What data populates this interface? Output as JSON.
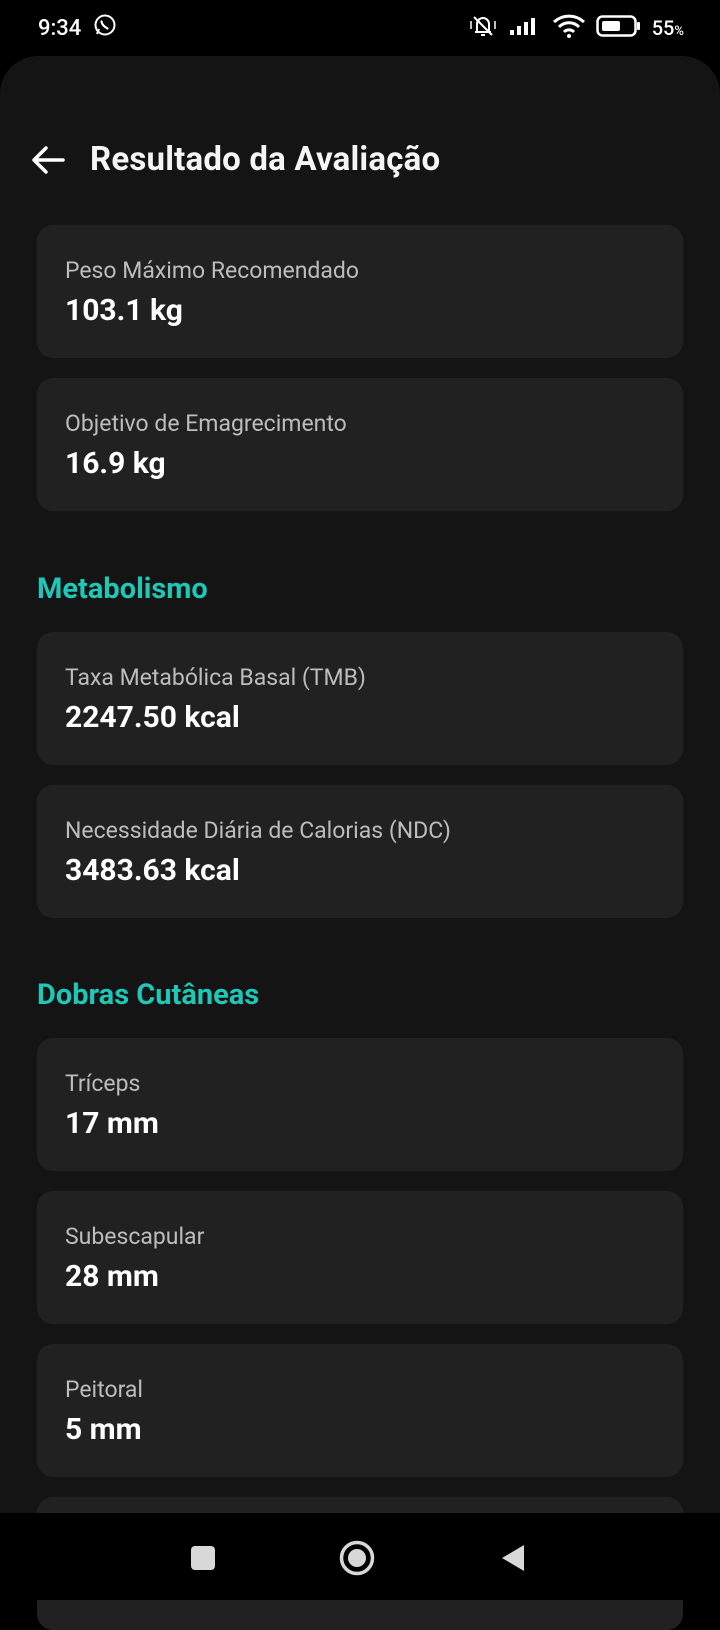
{
  "status_bar": {
    "time": "9:34",
    "battery_percent": "55",
    "battery_unit": "%",
    "icons": [
      "whatsapp-icon",
      "mute-icon",
      "signal-icon",
      "wifi-icon",
      "battery-icon"
    ]
  },
  "header": {
    "title": "Resultado da Avaliação"
  },
  "cards_top": [
    {
      "label": "Peso Máximo Recomendado",
      "value": "103.1 kg"
    },
    {
      "label": "Objetivo de Emagrecimento",
      "value": "16.9 kg"
    }
  ],
  "metabolismo": {
    "title": "Metabolismo",
    "cards": [
      {
        "label": "Taxa Metabólica Basal (TMB)",
        "value": "2247.50 kcal"
      },
      {
        "label": "Necessidade Diária de Calorias (NDC)",
        "value": "3483.63 kcal"
      }
    ]
  },
  "dobras": {
    "title": "Dobras Cutâneas",
    "cards": [
      {
        "label": "Tríceps",
        "value": "17 mm"
      },
      {
        "label": "Subescapular",
        "value": "28 mm"
      },
      {
        "label": "Peitoral",
        "value": "5 mm"
      }
    ]
  },
  "colors": {
    "accent": "#1fc7b6",
    "card": "#212121",
    "background": "#141414"
  },
  "nav_bar": {
    "icons": [
      "recents-square-icon",
      "home-circle-icon",
      "back-triangle-icon"
    ]
  }
}
